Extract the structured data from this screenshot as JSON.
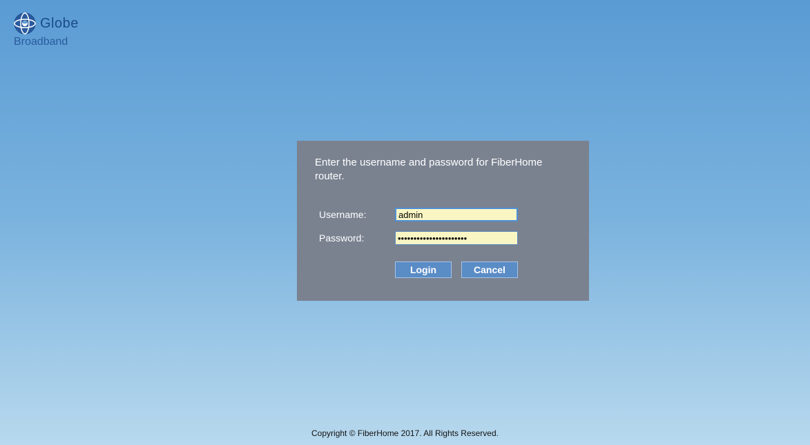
{
  "logo": {
    "brand": "Globe",
    "subbrand": "Broadband"
  },
  "login": {
    "instruction": "Enter the username and password for FiberHome router.",
    "username_label": "Username:",
    "password_label": "Password:",
    "username_value": "admin",
    "password_value": "••••••••••••••••••••••",
    "login_button": "Login",
    "cancel_button": "Cancel"
  },
  "footer": {
    "text": "Copyright © FiberHome 2017. All Rights Reserved."
  }
}
